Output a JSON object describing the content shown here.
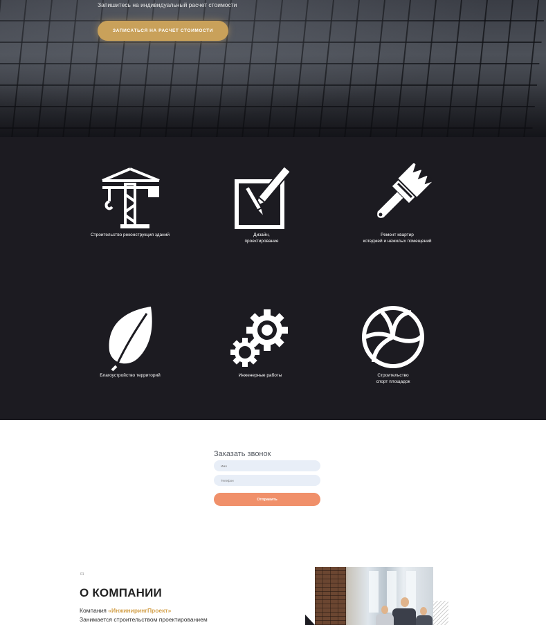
{
  "hero": {
    "subtitle": "Запишитесь на индивидуальный расчет стоимости",
    "cta_label": "Записаться на расчет стоимости"
  },
  "services": [
    {
      "label": "Строительство реконструкция зданий",
      "icon": "crane-icon"
    },
    {
      "label": "Дизайн,\nпроектирование",
      "icon": "design-tools-icon"
    },
    {
      "label": "Ремонт квартир\nкотеджей и нежилых помещений",
      "icon": "paint-brush-icon"
    },
    {
      "label": "Благоустройство территорий",
      "icon": "leaf-icon"
    },
    {
      "label": "Инженерные работы",
      "icon": "gears-icon"
    },
    {
      "label": "Строительство\nспорт площадок",
      "icon": "volleyball-icon"
    }
  ],
  "callback": {
    "title": "Заказать звонок",
    "name_placeholder": "Имя",
    "phone_placeholder": "Телефон",
    "submit_label": "Отправить"
  },
  "about": {
    "number": "01",
    "title": "О КОМПАНИИ",
    "line1_prefix": "Компания ",
    "brand": "«ИнжинирингПроект»",
    "line2": "Занимается строительством проектированием"
  },
  "colors": {
    "accent_gold": "#c9a15a",
    "dark_bg": "#1c1b21",
    "submit_orange": "#f0906a",
    "brand_text": "#d4a24e"
  }
}
